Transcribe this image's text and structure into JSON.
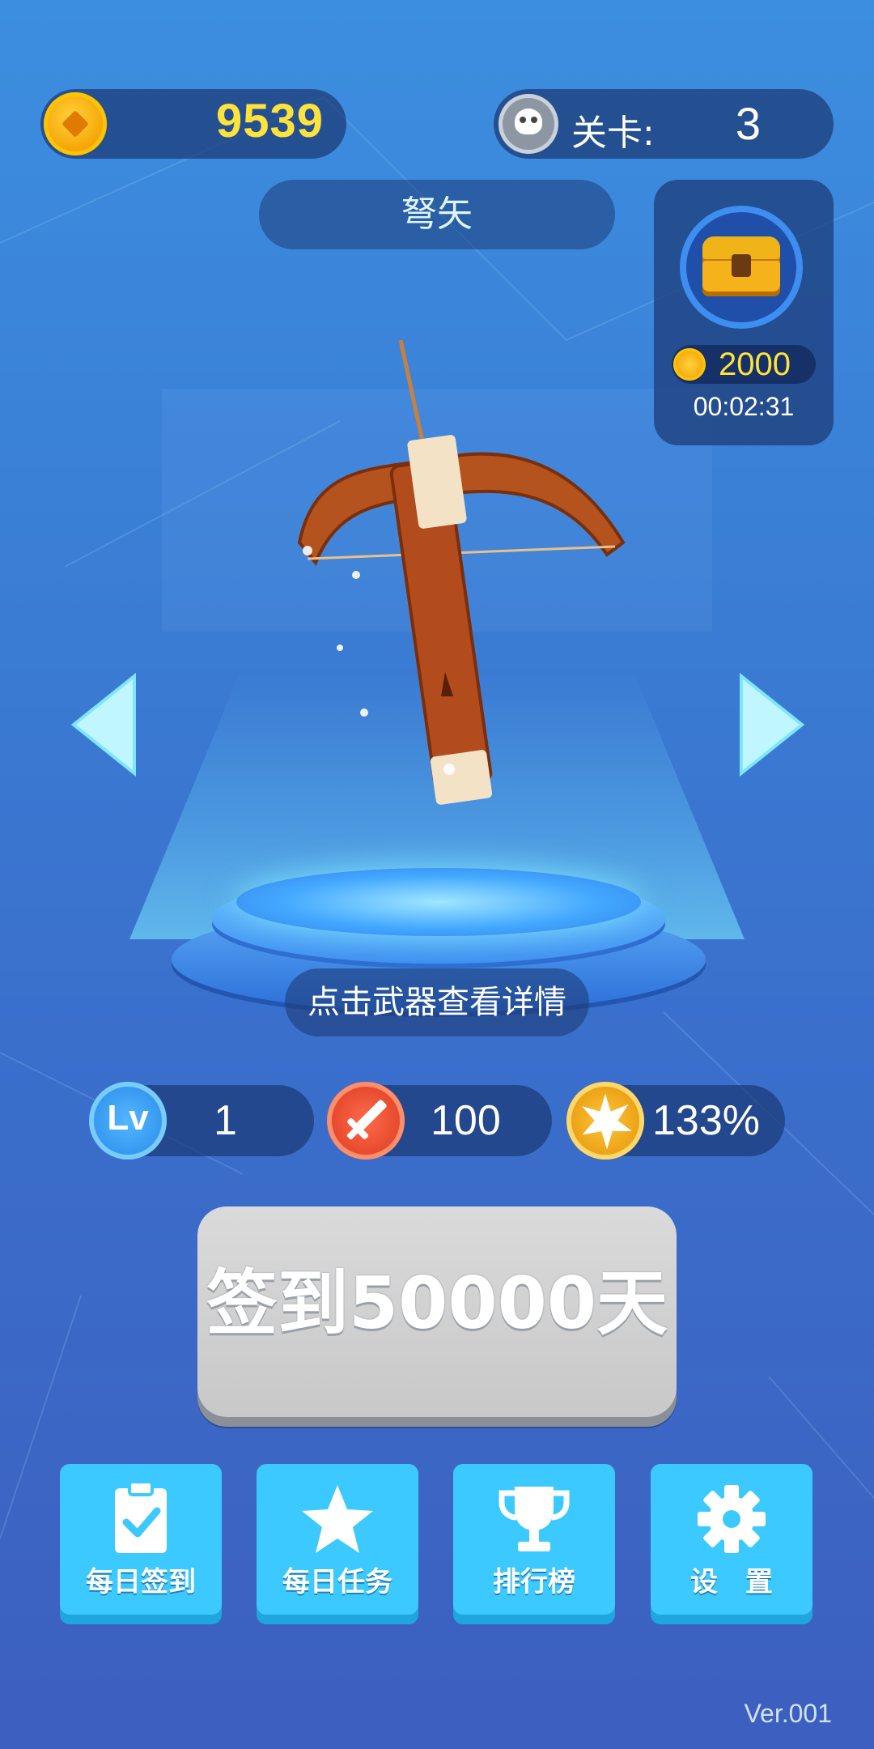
{
  "header": {
    "coins": "9539",
    "level_label": "关卡:",
    "level_value": "3"
  },
  "weapon": {
    "name": "弩矢",
    "hint": "点击武器查看详情"
  },
  "chest": {
    "reward": "2000",
    "timer": "00:02:31"
  },
  "stats": {
    "lv_badge": "Lv",
    "level": "1",
    "attack": "100",
    "crit": "133%"
  },
  "signin": {
    "label": "签到50000天"
  },
  "menu": {
    "items": [
      {
        "label": "每日签到",
        "icon": "clipboard-check-icon"
      },
      {
        "label": "每日任务",
        "icon": "star-icon"
      },
      {
        "label": "排行榜",
        "icon": "trophy-icon"
      },
      {
        "label": "设　置",
        "icon": "gear-icon"
      }
    ]
  },
  "version": "Ver.001",
  "colors": {
    "background": "#3a7fd6",
    "coin_text": "#ffe23a",
    "menu_button": "#3cc9ff",
    "signin_button": "#d0d0d0"
  }
}
